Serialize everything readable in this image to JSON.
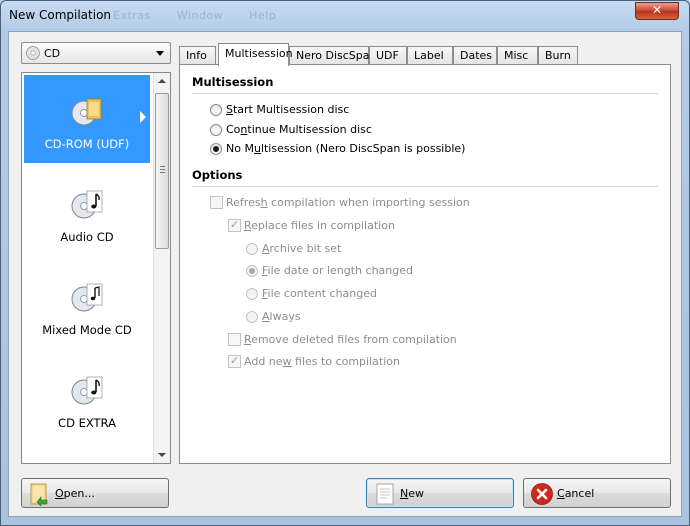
{
  "window": {
    "title": "New Compilation",
    "ghost_menu": [
      "Extras",
      "Window",
      "Help"
    ],
    "close_label": "✕"
  },
  "disc_type": {
    "selected": "CD"
  },
  "sidebar": {
    "items": [
      {
        "label": "CD-ROM (UDF)",
        "selected": true
      },
      {
        "label": "Audio CD",
        "selected": false
      },
      {
        "label": "Mixed Mode CD",
        "selected": false
      },
      {
        "label": "CD EXTRA",
        "selected": false
      }
    ]
  },
  "tabs": [
    {
      "label": "Info",
      "active": false
    },
    {
      "label": "Multisession",
      "active": true
    },
    {
      "label": "Nero DiscSpan",
      "active": false
    },
    {
      "label": "UDF",
      "active": false
    },
    {
      "label": "Label",
      "active": false
    },
    {
      "label": "Dates",
      "active": false
    },
    {
      "label": "Misc",
      "active": false
    },
    {
      "label": "Burn",
      "active": false
    }
  ],
  "multisession": {
    "title": "Multisession",
    "options": [
      {
        "pre": "",
        "u": "S",
        "post": "tart Multisession disc",
        "checked": false
      },
      {
        "pre": "Co",
        "u": "n",
        "post": "tinue Multisession disc",
        "checked": false
      },
      {
        "pre": "No M",
        "u": "u",
        "post": "ltisession (Nero DiscSpan is possible)",
        "checked": true
      }
    ]
  },
  "options": {
    "title": "Options",
    "refresh": {
      "pre": "Refres",
      "u": "h",
      "post": " compilation when importing session",
      "checked": false
    },
    "replace": {
      "pre": "",
      "u": "R",
      "post": "eplace files in compilation",
      "checked": true
    },
    "replace_modes": [
      {
        "pre": "",
        "u": "A",
        "post": "rchive bit set",
        "checked": false
      },
      {
        "pre": "",
        "u": "F",
        "post": "ile date or length changed",
        "checked": true
      },
      {
        "pre": "",
        "u": "F",
        "post": "ile content changed",
        "checked": false
      },
      {
        "pre": "",
        "u": "A",
        "post": "lways",
        "checked": false
      }
    ],
    "remove_deleted": {
      "pre": "",
      "u": "R",
      "post": "emove deleted files from compilation",
      "checked": false
    },
    "add_new": {
      "pre": "Add ne",
      "u": "w",
      "post": " files to compilation",
      "checked": true
    }
  },
  "buttons": {
    "open": {
      "u": "O",
      "post": "pen..."
    },
    "new": {
      "u": "N",
      "post": "ew"
    },
    "cancel": {
      "u": "C",
      "post": "ancel"
    }
  },
  "colors": {
    "selection": "#3399ff",
    "cancel_icon": "#d0281c"
  }
}
